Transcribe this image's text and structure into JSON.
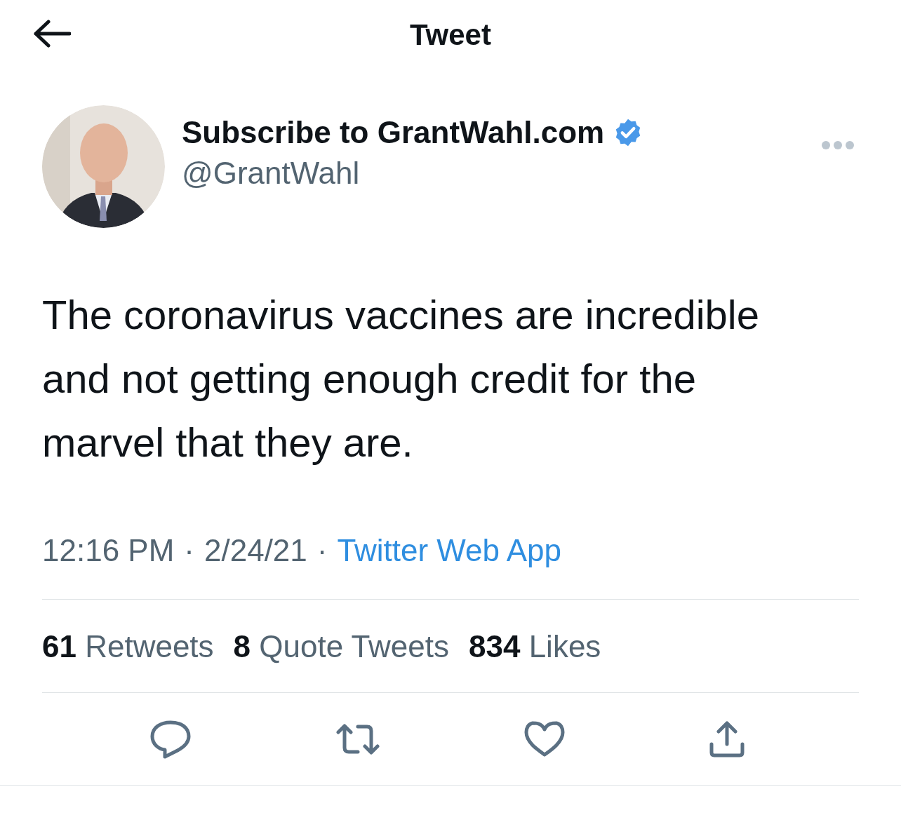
{
  "header": {
    "title": "Tweet"
  },
  "tweet": {
    "author": {
      "name": "Subscribe to GrantWahl.com",
      "handle": "@GrantWahl",
      "verified": true
    },
    "text": "The coronavirus vaccines are incredible and not getting enough credit for the marvel that they are.",
    "meta": [
      {
        "kind": "text",
        "text": "12:16 PM"
      },
      {
        "kind": "separator",
        "text": "·"
      },
      {
        "kind": "text",
        "text": "2/24/21"
      },
      {
        "kind": "separator",
        "text": "·"
      },
      {
        "kind": "link",
        "text": "Twitter Web App"
      }
    ]
  },
  "stats": [
    {
      "count": "61",
      "label": "Retweets"
    },
    {
      "count": "8",
      "label": "Quote Tweets"
    },
    {
      "count": "834",
      "label": "Likes"
    }
  ],
  "actions": [
    {
      "kind": "reply"
    },
    {
      "kind": "retweet"
    },
    {
      "kind": "like"
    },
    {
      "kind": "share"
    }
  ]
}
